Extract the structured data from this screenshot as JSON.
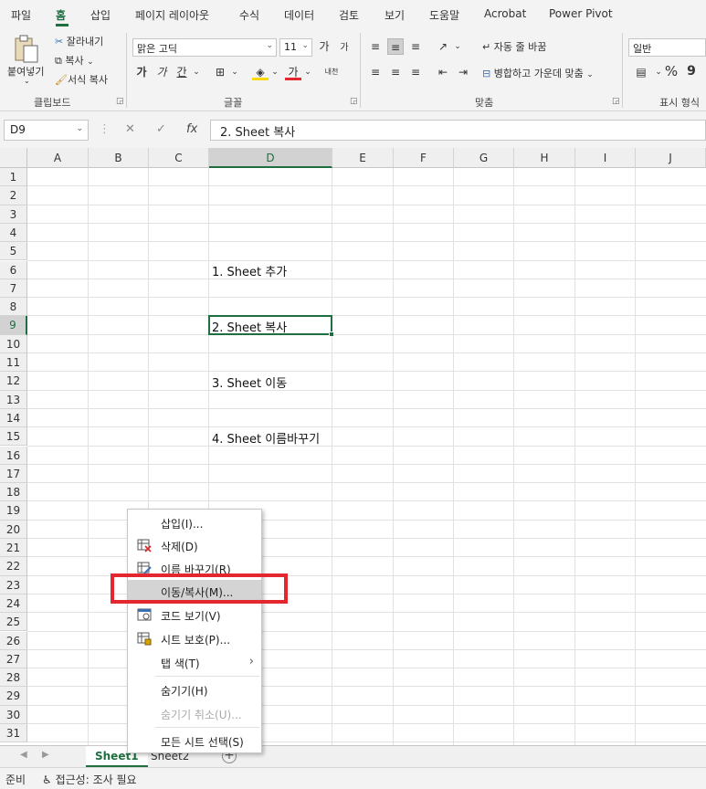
{
  "menu_tabs": [
    "파일",
    "홈",
    "삽입",
    "페이지 레이아웃",
    "수식",
    "데이터",
    "검토",
    "보기",
    "도움말",
    "Acrobat",
    "Power Pivot"
  ],
  "ribbon": {
    "clipboard": {
      "paste": "붙여넣기",
      "cut": "잘라내기",
      "copy": "복사",
      "format_painter": "서식 복사",
      "group": "클립보드"
    },
    "font": {
      "font_name": "맑은 고딕",
      "font_size": "11",
      "grow": "가",
      "shrink": "가",
      "bold": "가",
      "italic": "가",
      "underline": "간",
      "font_color": "가",
      "phonetic": "내천",
      "group": "글꼴"
    },
    "alignment": {
      "wrap": "자동 줄 바꿈",
      "merge": "병합하고 가운데 맞춤",
      "group": "맞춤"
    },
    "number": {
      "format": "일반",
      "percent": "%",
      "comma": "9",
      "group": "표시 형식"
    }
  },
  "formula_bar": {
    "name_box": "D9",
    "cancel": "✕",
    "enter": "✓",
    "fx": "fx",
    "content": "2. Sheet 복사"
  },
  "columns": [
    "A",
    "B",
    "C",
    "D",
    "E",
    "F",
    "G",
    "H",
    "I",
    "J"
  ],
  "rows": [
    "1",
    "2",
    "3",
    "4",
    "5",
    "6",
    "7",
    "8",
    "9",
    "10",
    "11",
    "12",
    "13",
    "14",
    "15",
    "16",
    "17",
    "18",
    "19",
    "20",
    "21",
    "22",
    "23",
    "24",
    "25",
    "26",
    "27",
    "28",
    "29",
    "30",
    "31"
  ],
  "selected_cell": {
    "column": "D",
    "row": "9"
  },
  "cells": {
    "D6": "1. Sheet 추가",
    "D9": "2. Sheet 복사",
    "D12": "3. Sheet 이동",
    "D15": "4. Sheet 이름바꾸기"
  },
  "context_menu": {
    "items": [
      {
        "label": "삽입(I)...",
        "icon": ""
      },
      {
        "label": "삭제(D)",
        "icon": "delete-sheet-icon"
      },
      {
        "label": "이름 바꾸기(R)",
        "icon": "rename-sheet-icon"
      },
      {
        "label": "이동/복사(M)...",
        "icon": "",
        "highlighted": true
      },
      {
        "label": "코드 보기(V)",
        "icon": "view-code-icon"
      },
      {
        "label": "시트 보호(P)...",
        "icon": "protect-sheet-icon"
      },
      {
        "label": "탭 색(T)",
        "icon": "",
        "submenu": "›"
      },
      {
        "label": "숨기기(H)",
        "icon": ""
      },
      {
        "label": "숨기기 취소(U)...",
        "icon": "",
        "disabled": true
      },
      {
        "label": "모든 시트 선택(S)",
        "icon": ""
      }
    ],
    "highlight_box_color": "#e4262e"
  },
  "sheet_tabs": {
    "tabs": [
      "Sheet1",
      "Sheet2"
    ],
    "active": "Sheet1",
    "add_symbol": "+",
    "prev": "◀",
    "next": "▶"
  },
  "status_bar": {
    "ready": "준비",
    "accessibility": "접근성: 조사 필요"
  },
  "colors": {
    "accent": "#1e6e3f",
    "highlight_red": "#e4262e"
  }
}
